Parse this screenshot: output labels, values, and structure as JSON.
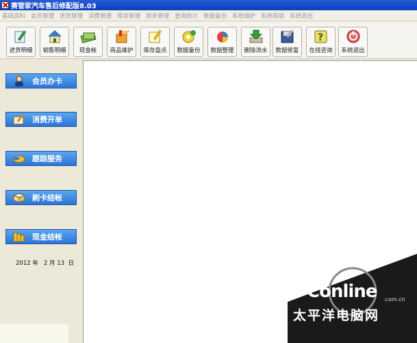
{
  "window": {
    "title": "赛管家汽车售后修配版8.03"
  },
  "menu": [
    "基础资料",
    "会员管理",
    "进货管理",
    "消费管理",
    "库存管理",
    "财务管理",
    "查询统计",
    "数据备份",
    "系统维护",
    "系统帮助",
    "系统退出"
  ],
  "toolbar": [
    {
      "label": "进货明细",
      "icon": "pencil-document-icon"
    },
    {
      "label": "销售明细",
      "icon": "house-icon"
    },
    {
      "label": "现金帐",
      "icon": "cash-bundle-icon"
    },
    {
      "label": "商品维护",
      "icon": "box-icon"
    },
    {
      "label": "库存盘点",
      "icon": "pencil-check-icon"
    },
    {
      "label": "数据备份",
      "icon": "backup-disk-icon"
    },
    {
      "label": "数据整理",
      "icon": "pie-tools-icon"
    },
    {
      "label": "删除流水",
      "icon": "download-arrow-icon"
    },
    {
      "label": "数据修复",
      "icon": "repair-disk-icon"
    },
    {
      "label": "在线咨询",
      "icon": "question-icon"
    },
    {
      "label": "系统退出",
      "icon": "power-icon"
    }
  ],
  "sidebar": {
    "buttons": [
      {
        "label": "会员办卡",
        "icon": "person-icon"
      },
      {
        "label": "消费开单",
        "icon": "write-note-icon"
      },
      {
        "label": "跟踪服务",
        "icon": "handshake-icon"
      },
      {
        "label": "刷卡结帐",
        "icon": "card-book-icon"
      },
      {
        "label": "现金结帐",
        "icon": "coins-icon"
      }
    ],
    "date": "2012 年   2 月 13  日"
  },
  "watermark": {
    "brand": "PConline",
    "domain": ".com.cn",
    "cn": "太平洋电脑网"
  }
}
